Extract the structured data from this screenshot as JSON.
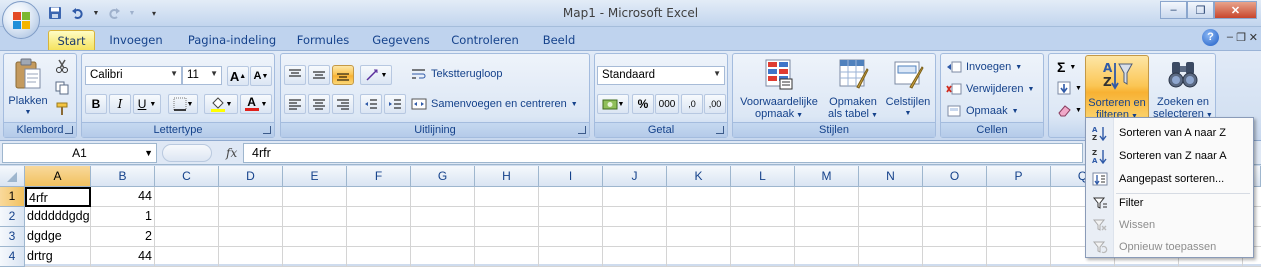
{
  "window": {
    "title": "Map1 - Microsoft Excel",
    "minimize": "–",
    "restore": "❐",
    "close": "✕",
    "ribbon_minimize": "–",
    "ribbon_restore": "❐",
    "ribbon_close": "✕"
  },
  "tabs": [
    {
      "label": "Start"
    },
    {
      "label": "Invoegen"
    },
    {
      "label": "Pagina-indeling"
    },
    {
      "label": "Formules"
    },
    {
      "label": "Gegevens"
    },
    {
      "label": "Controleren"
    },
    {
      "label": "Beeld"
    }
  ],
  "help": "?",
  "clipboard": {
    "label": "Klembord",
    "paste": "Plakken"
  },
  "font": {
    "label": "Lettertype",
    "name": "Calibri",
    "size": "11",
    "bold": "B",
    "italic": "I",
    "underline": "U",
    "grow": "A",
    "shrink": "A",
    "font_color": "A"
  },
  "alignment": {
    "label": "Uitlijning",
    "wrap": "Tekstterugloop",
    "merge": "Samenvoegen en centreren"
  },
  "number": {
    "label": "Getal",
    "format": "Standaard",
    "percent": "%",
    "thousands": "000",
    "inc_decimal": ",0",
    "dec_decimal": ",00"
  },
  "styles": {
    "label": "Stijlen",
    "conditional": [
      "Voorwaardelijke",
      "opmaak"
    ],
    "table": [
      "Opmaken",
      "als tabel"
    ],
    "cell_styles": "Celstijlen"
  },
  "cells": {
    "label": "Cellen",
    "insert": "Invoegen",
    "delete": "Verwijderen",
    "format": "Opmaak"
  },
  "editing": {
    "sort_filter": [
      "Sorteren en",
      "filteren"
    ],
    "find_select": [
      "Zoeken en",
      "selecteren"
    ]
  },
  "formula_bar": {
    "name_box": "A1",
    "fx": "fx",
    "value": "4rfr"
  },
  "columns": [
    "A",
    "B",
    "C",
    "D",
    "E",
    "F",
    "G",
    "H",
    "I",
    "J",
    "K",
    "L",
    "M",
    "N",
    "O",
    "P",
    "Q"
  ],
  "rows": [
    {
      "num": "1",
      "a": "4rfr",
      "b": "44"
    },
    {
      "num": "2",
      "a": "ddddddgdg",
      "b": "1"
    },
    {
      "num": "3",
      "a": "dgdge",
      "b": "2"
    },
    {
      "num": "4",
      "a": "drtrg",
      "b": "44"
    }
  ],
  "sort_menu": {
    "items": [
      {
        "label": "Sorteren van A naar Z",
        "disabled": false
      },
      {
        "label": "Sorteren van Z naar A",
        "disabled": false
      },
      {
        "label": "Aangepast sorteren...",
        "disabled": false
      },
      {
        "label": "Filter",
        "disabled": false
      },
      {
        "label": "Wissen",
        "disabled": true
      },
      {
        "label": "Opnieuw toepassen",
        "disabled": true
      }
    ]
  },
  "colors": {
    "accent": "#15428b",
    "active_tab": "#f5e25e",
    "selection": "#f1c15f",
    "grid": "#d4d4d4"
  }
}
